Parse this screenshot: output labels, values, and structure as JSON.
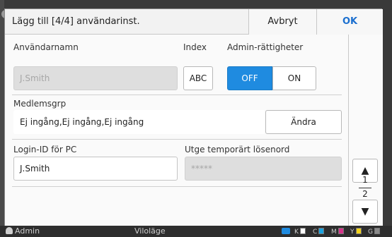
{
  "header": {
    "title": "Lägg till [4/4] användarinst.",
    "cancel_label": "Avbryt",
    "ok_label": "OK"
  },
  "username": {
    "label": "Användarnamn",
    "value": "J.Smith"
  },
  "index": {
    "label": "Index",
    "button_label": "ABC"
  },
  "admin": {
    "label": "Admin-rättigheter",
    "off_label": "OFF",
    "on_label": "ON",
    "selected": "OFF"
  },
  "group": {
    "label": "Medlemsgrp",
    "value": "Ej ingång,Ej ingång,Ej ingång",
    "change_label": "Ändra"
  },
  "login": {
    "label": "Login-ID för PC",
    "value": "J.Smith"
  },
  "temp_password": {
    "label": "Utge temporärt lösenord",
    "value": "*****"
  },
  "pager": {
    "current": "1",
    "total": "2",
    "up_icon": "▲",
    "down_icon": "▼"
  },
  "statusbar": {
    "user": "Admin",
    "mode": "Viloläge",
    "inks": [
      {
        "label": "K",
        "color": "#ffffff"
      },
      {
        "label": "C",
        "color": "#1aa3e0"
      },
      {
        "label": "M",
        "color": "#d6338a"
      },
      {
        "label": "Y",
        "color": "#f2d21a"
      },
      {
        "label": "G",
        "color": "#8a8a8a"
      }
    ],
    "accent": "#1f8be0"
  }
}
